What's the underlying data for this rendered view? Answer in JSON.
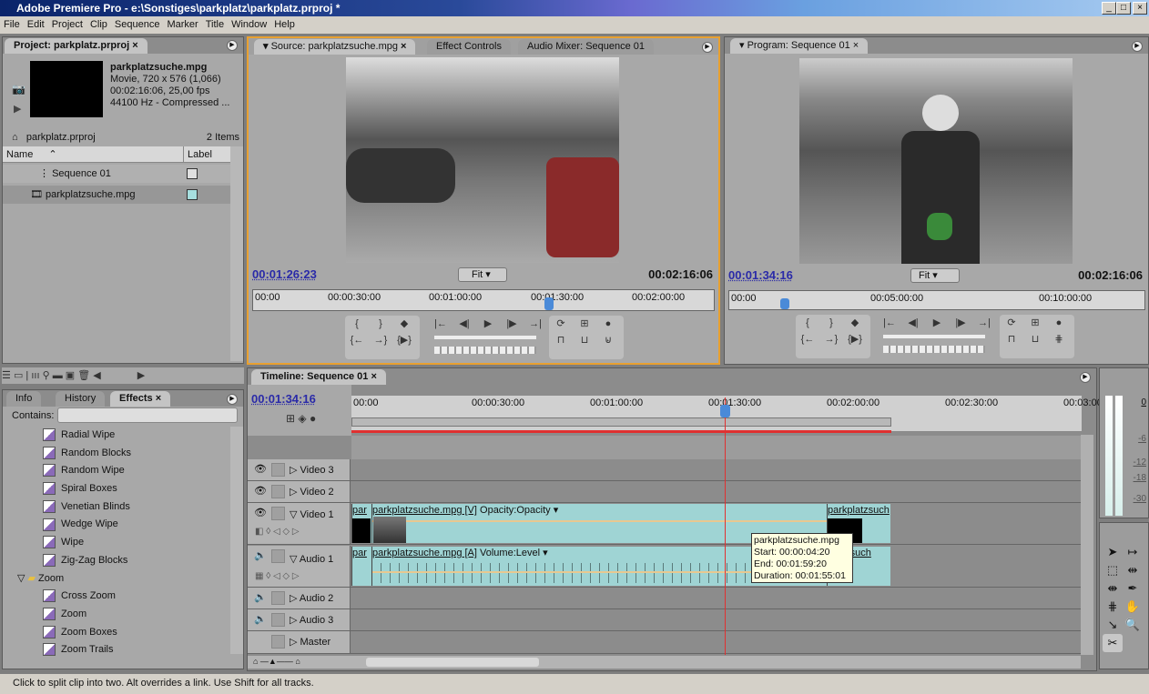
{
  "window": {
    "title": "Adobe Premiere Pro - e:\\Sonstiges\\parkplatz\\parkplatz.prproj *",
    "controls": [
      "_",
      "□",
      "×"
    ]
  },
  "menu": [
    "File",
    "Edit",
    "Project",
    "Clip",
    "Sequence",
    "Marker",
    "Title",
    "Window",
    "Help"
  ],
  "project": {
    "tab": "Project: parkplatz.prproj",
    "preview": {
      "name": "parkplatzsuche.mpg",
      "line1": "Movie, 720 x 576 (1,066)",
      "line2": "00:02:16:06, 25,00 fps",
      "line3": "44100 Hz - Compressed ..."
    },
    "bin": "parkplatz.prproj",
    "count": "2 Items",
    "columns": [
      "Name",
      "Label"
    ],
    "items": [
      {
        "name": "Sequence 01",
        "label_color": "#e0e0e0"
      },
      {
        "name": "parkplatzsuche.mpg",
        "label_color": "#a6dede"
      }
    ]
  },
  "effects": {
    "tabs": [
      "Info",
      "History",
      "Effects"
    ],
    "contains_label": "Contains:",
    "contains_value": "",
    "items": [
      {
        "label": "Radial Wipe",
        "type": "effect"
      },
      {
        "label": "Random Blocks",
        "type": "effect"
      },
      {
        "label": "Random Wipe",
        "type": "effect"
      },
      {
        "label": "Spiral Boxes",
        "type": "effect"
      },
      {
        "label": "Venetian Blinds",
        "type": "effect"
      },
      {
        "label": "Wedge Wipe",
        "type": "effect"
      },
      {
        "label": "Wipe",
        "type": "effect"
      },
      {
        "label": "Zig-Zag Blocks",
        "type": "effect"
      },
      {
        "label": "Zoom",
        "type": "folder"
      },
      {
        "label": "Cross Zoom",
        "type": "effect"
      },
      {
        "label": "Zoom",
        "type": "effect"
      },
      {
        "label": "Zoom Boxes",
        "type": "effect"
      },
      {
        "label": "Zoom Trails",
        "type": "effect"
      }
    ]
  },
  "source": {
    "tabs": [
      "Source: parkplatzsuche.mpg",
      "Effect Controls",
      "Audio Mixer: Sequence 01"
    ],
    "timecode": "00:01:26:23",
    "fit": "Fit",
    "duration": "00:02:16:06",
    "ruler": [
      "00:00",
      "00:00:30:00",
      "00:01:00:00",
      "00:01:30:00",
      "00:02:00:00"
    ],
    "playhead_fraction": 0.64
  },
  "program": {
    "tab": "Program: Sequence 01",
    "timecode": "00:01:34:16",
    "fit": "Fit",
    "duration": "00:02:16:06",
    "ruler": [
      "00:00",
      "00:05:00:00",
      "00:10:00:00"
    ]
  },
  "timeline": {
    "tab": "Timeline: Sequence 01",
    "timecode": "00:01:34:16",
    "ruler": [
      "00:00",
      "00:00:30:00",
      "00:01:00:00",
      "00:01:30:00",
      "00:02:00:00",
      "00:02:30:00",
      "00:03:00:00"
    ],
    "tracks": {
      "video3": "Video 3",
      "video2": "Video 2",
      "video1": "Video 1",
      "audio1": "Audio 1",
      "audio2": "Audio 2",
      "audio3": "Audio 3",
      "master": "Master"
    },
    "video_clips": [
      "par",
      "parkplatzsuche.mpg [V]",
      "Opacity:Opacity ▾",
      "parkplatzsuch"
    ],
    "audio_clips": [
      "par",
      "parkplatzsuche.mpg [A]",
      "Volume:Level ▾",
      "parkplatzsuch"
    ],
    "tooltip": [
      "parkplatzsuche.mpg",
      "Start: 00:00:04:20",
      "End: 00:01:59:20",
      "Duration: 00:01:55:01"
    ]
  },
  "meter": {
    "labels": [
      "0",
      "-6",
      "-12",
      "-18",
      "-30"
    ]
  },
  "status": "Click to split clip into two. Alt overrides a link. Use Shift for all tracks.",
  "colors": {
    "accent_timecode": "#2a2aa8",
    "active_panel": "#e8a030",
    "playhead": "#e03030",
    "clip": "#9fd4d4"
  }
}
